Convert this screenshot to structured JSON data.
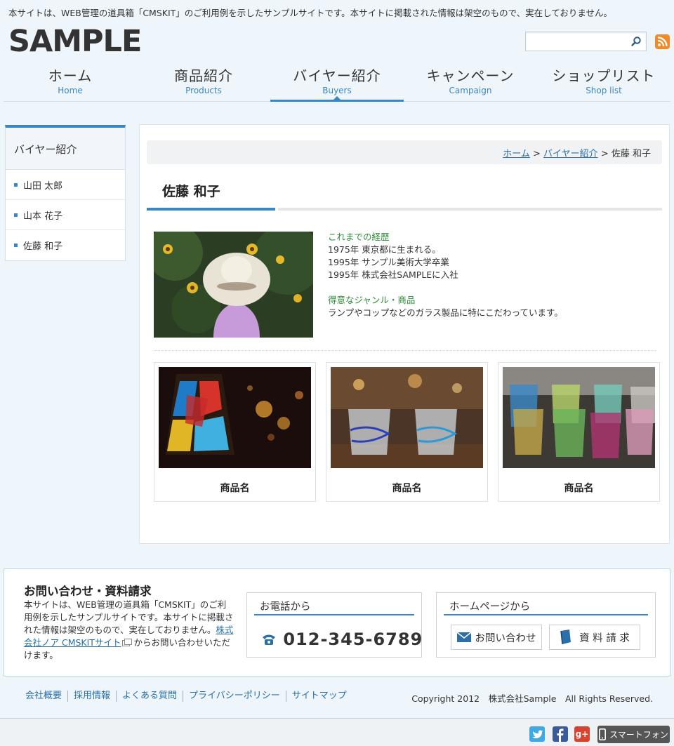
{
  "notice": "本サイトは、WEB管理の道具箱「CMSKIT」のご利用例を示したサンプルサイトです。本サイトに掲載された情報は架空のもので、実在しておりません。",
  "logo": "SAMPLE",
  "search": {
    "placeholder": ""
  },
  "nav": [
    {
      "jp": "ホーム",
      "en": "Home"
    },
    {
      "jp": "商品紹介",
      "en": "Products"
    },
    {
      "jp": "バイヤー紹介",
      "en": "Buyers"
    },
    {
      "jp": "キャンペーン",
      "en": "Campaign"
    },
    {
      "jp": "ショップリスト",
      "en": "Shop list"
    }
  ],
  "active_nav": "Buyers",
  "sidebar": {
    "title": "バイヤー紹介",
    "items": [
      "山田 太郎",
      "山本 花子",
      "佐藤 和子"
    ]
  },
  "breadcrumb": {
    "home": "ホーム",
    "section": "バイヤー紹介",
    "sep": ">",
    "current": "佐藤 和子"
  },
  "page_title": "佐藤 和子",
  "bio": {
    "career_heading": "これまでの経歴",
    "career": [
      "1975年 東京都に生まれる。",
      "1995年 サンプル美術大学卒業",
      "1995年 株式会社SAMPLEに入社"
    ],
    "genre_heading": "得意なジャンル・商品",
    "genre": "ランプやコップなどのガラス製品に特にこだわっています。"
  },
  "products": [
    {
      "name": "商品名"
    },
    {
      "name": "商品名"
    },
    {
      "name": "商品名"
    }
  ],
  "contact": {
    "title": "お問い合わせ・資料請求",
    "text_before": "本サイトは、WEB管理の道具箱「CMSKIT」のご利用例を示したサンプルサイトです。本サイトに掲載された情報は架空のもので、実在しておりません。",
    "link": "株式会社ノア CMSKITサイト",
    "text_after": "からお問い合わせいただけます。",
    "phone_heading": "お電話から",
    "phone": "012-345-6789",
    "web_heading": "ホームページから",
    "inquiry_button": "お問い合わせ",
    "request_button": "資 料 請 求"
  },
  "footer": {
    "links": [
      "会社概要",
      "採用情報",
      "よくある質問",
      "プライバシーポリシー",
      "サイトマップ"
    ],
    "copyright": "Copyright 2012　株式会社Sample　All Rights Reserved.",
    "smartphone": "スマートフォン"
  },
  "colors": {
    "accent": "#3a86c5",
    "bg": "#eff6fb",
    "green_heading": "#2d8a35",
    "rss": "#f28a2b"
  }
}
